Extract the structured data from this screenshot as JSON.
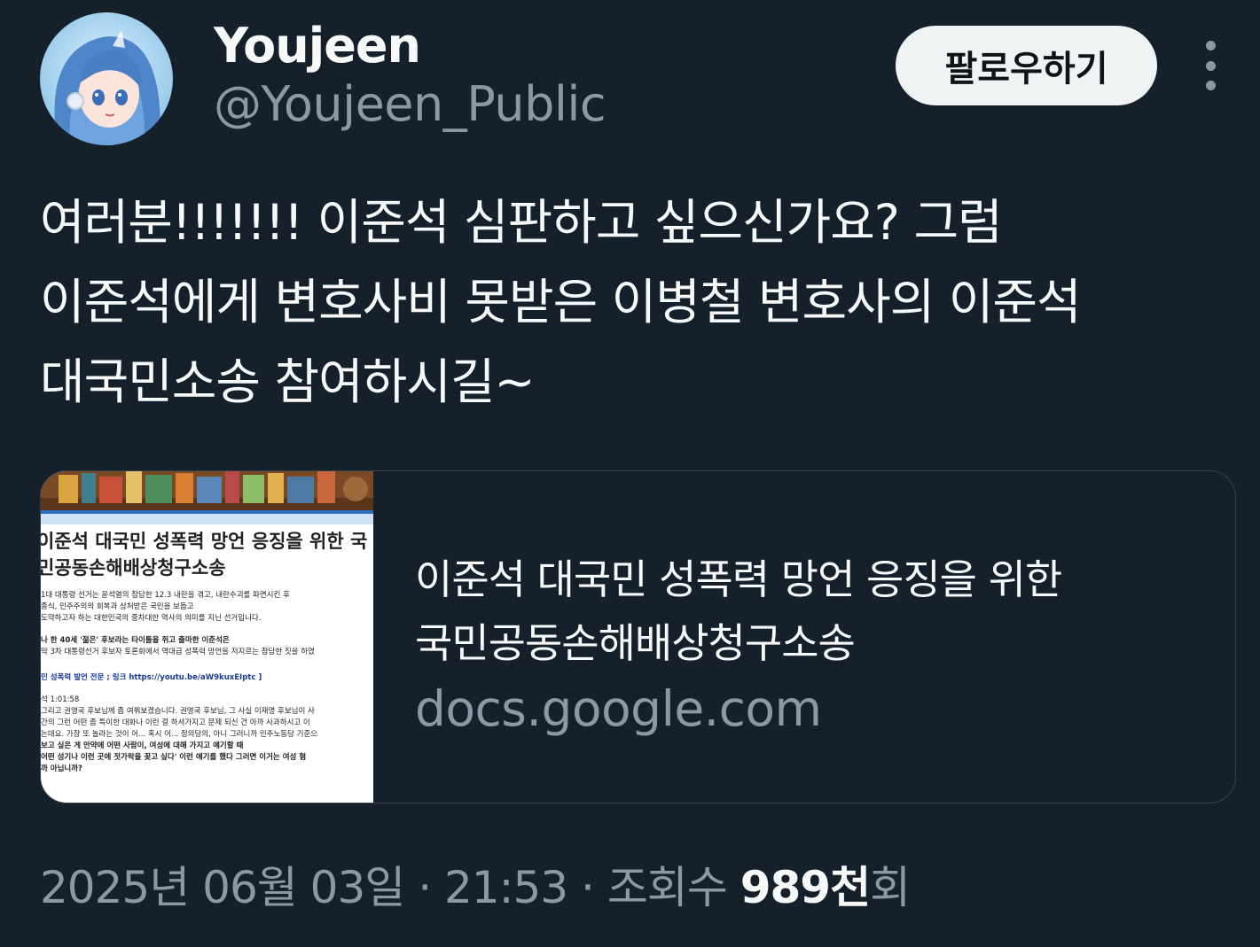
{
  "author": {
    "display_name": "Youjeen",
    "handle": "@Youjeen_Public"
  },
  "follow_button": {
    "label": "팔로우하기"
  },
  "tweet": {
    "lines": [
      "여러분!!!!!!! 이준석 심판하고 싶으신가요? 그럼",
      "이준석에게 변호사비 못받은 이병철 변호사의 이준석",
      "대국민소송 참여하시길~"
    ]
  },
  "link_card": {
    "title_lines": [
      "이준석 대국민 성폭력 망언 응징을 위한",
      "국민공동손해배상청구소송"
    ],
    "domain": "docs.google.com",
    "thumbnail": {
      "heading_lines": [
        "이준석 대국민 성폭력 망언 응징을 위한 국",
        "민공동손해배상청구소송"
      ],
      "body_lines": [
        "1대 대통령 선거는 윤석열의 참담한 12.3 내란을 겪고, 내란수괴를 파면시킨 후",
        "종식, 민주주의의 회복과 상처받은 국민을 보듬고",
        "도약하고자 하는 대한민국의 중차대한 역사의 의미를 지닌 선거입니다.",
        "나 한 40세 '젊은' 후보라는 타이틀을 쥐고 출마한 이준석은",
        "막 3차 대통령선거 후보자 토론회에서 역대급 성폭력 망언을 저지르는 참담한 짓을 하였",
        "민 성폭력 발언 전문 ; 링크 https://youtu.be/aW9kuxEIptc ]",
        "석 1:01:58",
        "그리고 권영국 후보님께 좀 여쭤보겠습니다. 권영국 후보님, 그 사실 이재명 후보님이 사",
        "간의 그런 어떤 좀 특이한 대화나 이런 걸 하셔가지고 문제 되신 건 아까 사과하시고 이",
        "는데요. 가장 또 놀라는 것이 어... 혹시 어... 정의당의, 아니 그러니까 민주노동당 기준으",
        "보고 싶은 게 만약에 어떤 사람이, 여성에 대해 가지고 얘기할 때",
        "어떤 성기나 이런 곳에 젓가락을 꽂고 싶다' 이런 얘기를 했다 그러면 이거는 여성 혐",
        "까 아닙니까?"
      ]
    }
  },
  "meta": {
    "date": "2025년 06월 03일",
    "separator": "·",
    "time": "21:53",
    "views_label": "조회수",
    "views_count": "989천",
    "views_suffix": "회"
  },
  "colors": {
    "background": "#15202b",
    "primary_text": "#f7f9f9",
    "secondary_text": "#8b98a5",
    "border": "#38444d",
    "button_bg": "#eff3f4"
  }
}
